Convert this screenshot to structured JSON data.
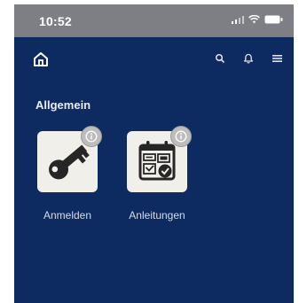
{
  "status_bar": {
    "time": "10:52"
  },
  "section": {
    "title": "Allgemein"
  },
  "tiles": [
    {
      "label": "Anmelden",
      "icon": "key-icon"
    },
    {
      "label": "Anleitungen",
      "icon": "calendar-checklist-icon"
    }
  ],
  "colors": {
    "background": "#0d2b60",
    "status_bar": "#7e7f84",
    "tile": "#f0efea",
    "icon": "#262626",
    "badge": "#bdbdbd"
  }
}
